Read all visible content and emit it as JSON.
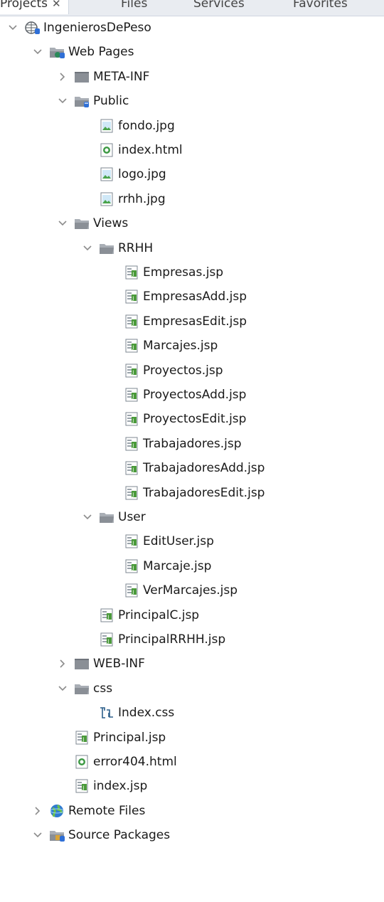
{
  "tabs": [
    {
      "label": "Projects",
      "close": "✕"
    },
    {
      "label": "Files"
    },
    {
      "label": "Services"
    },
    {
      "label": "Favorites"
    }
  ],
  "tree": [
    {
      "label": "IngenierosDePeso",
      "icon": "web-project-icon",
      "depth": 0,
      "toggle": "expanded"
    },
    {
      "label": "Web Pages",
      "icon": "web-pages-folder-icon",
      "depth": 1,
      "toggle": "expanded"
    },
    {
      "label": "META-INF",
      "icon": "folder-closed-icon",
      "depth": 2,
      "toggle": "collapsed"
    },
    {
      "label": "Public",
      "icon": "folder-open-db-icon",
      "depth": 2,
      "toggle": "expanded"
    },
    {
      "label": "fondo.jpg",
      "icon": "image-file-icon",
      "depth": 3,
      "toggle": "none"
    },
    {
      "label": "index.html",
      "icon": "html-file-icon",
      "depth": 3,
      "toggle": "none"
    },
    {
      "label": "logo.jpg",
      "icon": "image-file-icon",
      "depth": 3,
      "toggle": "none"
    },
    {
      "label": "rrhh.jpg",
      "icon": "image-file-icon",
      "depth": 3,
      "toggle": "none"
    },
    {
      "label": "Views",
      "icon": "folder-open-icon",
      "depth": 2,
      "toggle": "expanded"
    },
    {
      "label": "RRHH",
      "icon": "folder-open-icon",
      "depth": 3,
      "toggle": "expanded"
    },
    {
      "label": "Empresas.jsp",
      "icon": "jsp-file-icon",
      "depth": 4,
      "toggle": "none"
    },
    {
      "label": "EmpresasAdd.jsp",
      "icon": "jsp-file-icon",
      "depth": 4,
      "toggle": "none"
    },
    {
      "label": "EmpresasEdit.jsp",
      "icon": "jsp-file-icon",
      "depth": 4,
      "toggle": "none"
    },
    {
      "label": "Marcajes.jsp",
      "icon": "jsp-file-icon",
      "depth": 4,
      "toggle": "none"
    },
    {
      "label": "Proyectos.jsp",
      "icon": "jsp-file-icon",
      "depth": 4,
      "toggle": "none"
    },
    {
      "label": "ProyectosAdd.jsp",
      "icon": "jsp-file-icon",
      "depth": 4,
      "toggle": "none"
    },
    {
      "label": "ProyectosEdit.jsp",
      "icon": "jsp-file-icon",
      "depth": 4,
      "toggle": "none"
    },
    {
      "label": "Trabajadores.jsp",
      "icon": "jsp-file-icon",
      "depth": 4,
      "toggle": "none"
    },
    {
      "label": "TrabajadoresAdd.jsp",
      "icon": "jsp-file-icon",
      "depth": 4,
      "toggle": "none"
    },
    {
      "label": "TrabajadoresEdit.jsp",
      "icon": "jsp-file-icon",
      "depth": 4,
      "toggle": "none"
    },
    {
      "label": "User",
      "icon": "folder-open-icon",
      "depth": 3,
      "toggle": "expanded"
    },
    {
      "label": "EditUser.jsp",
      "icon": "jsp-file-icon",
      "depth": 4,
      "toggle": "none"
    },
    {
      "label": "Marcaje.jsp",
      "icon": "jsp-file-icon",
      "depth": 4,
      "toggle": "none"
    },
    {
      "label": "VerMarcajes.jsp",
      "icon": "jsp-file-icon",
      "depth": 4,
      "toggle": "none"
    },
    {
      "label": "PrincipalC.jsp",
      "icon": "jsp-file-icon",
      "depth": 3,
      "toggle": "none"
    },
    {
      "label": "PrincipalRRHH.jsp",
      "icon": "jsp-file-icon",
      "depth": 3,
      "toggle": "none"
    },
    {
      "label": "WEB-INF",
      "icon": "folder-closed-icon",
      "depth": 2,
      "toggle": "collapsed"
    },
    {
      "label": "css",
      "icon": "folder-open-icon",
      "depth": 2,
      "toggle": "expanded"
    },
    {
      "label": "Index.css",
      "icon": "css-file-icon",
      "depth": 3,
      "toggle": "none"
    },
    {
      "label": "Principal.jsp",
      "icon": "jsp-file-icon",
      "depth": 2,
      "toggle": "none"
    },
    {
      "label": "error404.html",
      "icon": "html-file-icon",
      "depth": 2,
      "toggle": "none"
    },
    {
      "label": "index.jsp",
      "icon": "jsp-file-icon",
      "depth": 2,
      "toggle": "none"
    },
    {
      "label": "Remote Files",
      "icon": "globe-icon",
      "depth": 1,
      "toggle": "collapsed"
    },
    {
      "label": "Source Packages",
      "icon": "source-packages-icon",
      "depth": 1,
      "toggle": "expanded"
    }
  ],
  "colors": {
    "folder": "#8a8f96",
    "chevron": "#8c8c8c",
    "db_badge": "#2f6fd6",
    "jsp_badge": "#4a9a3a",
    "html_badge": "#3e9a45"
  }
}
